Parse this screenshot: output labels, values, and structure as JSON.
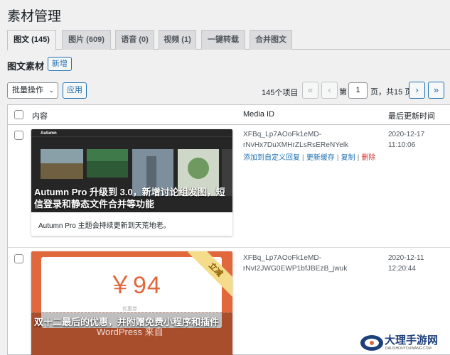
{
  "page": {
    "title": "素材管理",
    "section_title": "图文素材",
    "new_button": "新增"
  },
  "tabs": [
    {
      "label": "图文 (145)"
    },
    {
      "label": "图片 (609)"
    },
    {
      "label": "语音 (0)"
    },
    {
      "label": "视频 (1)"
    },
    {
      "label": "一键转载"
    },
    {
      "label": "合并图文"
    }
  ],
  "toolbar": {
    "bulk_select": "批量操作",
    "apply": "应用",
    "count": "145个项目",
    "first": "«",
    "prev": "‹",
    "page_prefix": "第",
    "page_value": "1",
    "page_suffix": "页，共15 页",
    "next": "›",
    "last": "»"
  },
  "table": {
    "headers": {
      "content": "内容",
      "media_id": "Media ID",
      "time": "最后更新时间"
    }
  },
  "rows": [
    {
      "media_id_1": "XFBq_Lp7AOoFk1eMD-",
      "media_id_2": "rNvHx7DuXMHrZLsRsEReNYelk",
      "time_1": "2020-12-17",
      "time_2": "11:10:06",
      "actions": {
        "a1": "添加到自定义回复",
        "a2": "更新缓存",
        "a3": "复制",
        "a4": "删除"
      },
      "card": {
        "overlay": "Autumn Pro 升级到 3.0，新增讨论组发图，短信登录和静态文件合并等功能",
        "desc": "Autumn Pro 主题会持续更新到天荒地老。",
        "site": "Autumn"
      }
    },
    {
      "media_id_1": "XFBq_Lp7AOoFk1eMD-",
      "media_id_2": "rNvI2JWG0EWP1bfJBEzB_jwuk",
      "time_1": "2020-12-11",
      "time_2": "12:20:44",
      "card": {
        "price": "￥94",
        "ribbon": "立减",
        "coupon_small": "优惠券",
        "brand": "WordPress 来自",
        "overlay": "双十二最后的优惠，并附赠免费小程序和插件"
      }
    }
  ],
  "watermark": {
    "text": "大理手游网",
    "sub": "DALISHOUYOUWANG.COM"
  },
  "colors": {
    "accent": "#2271b1",
    "danger": "#d63638",
    "coupon": "#e0683c"
  }
}
